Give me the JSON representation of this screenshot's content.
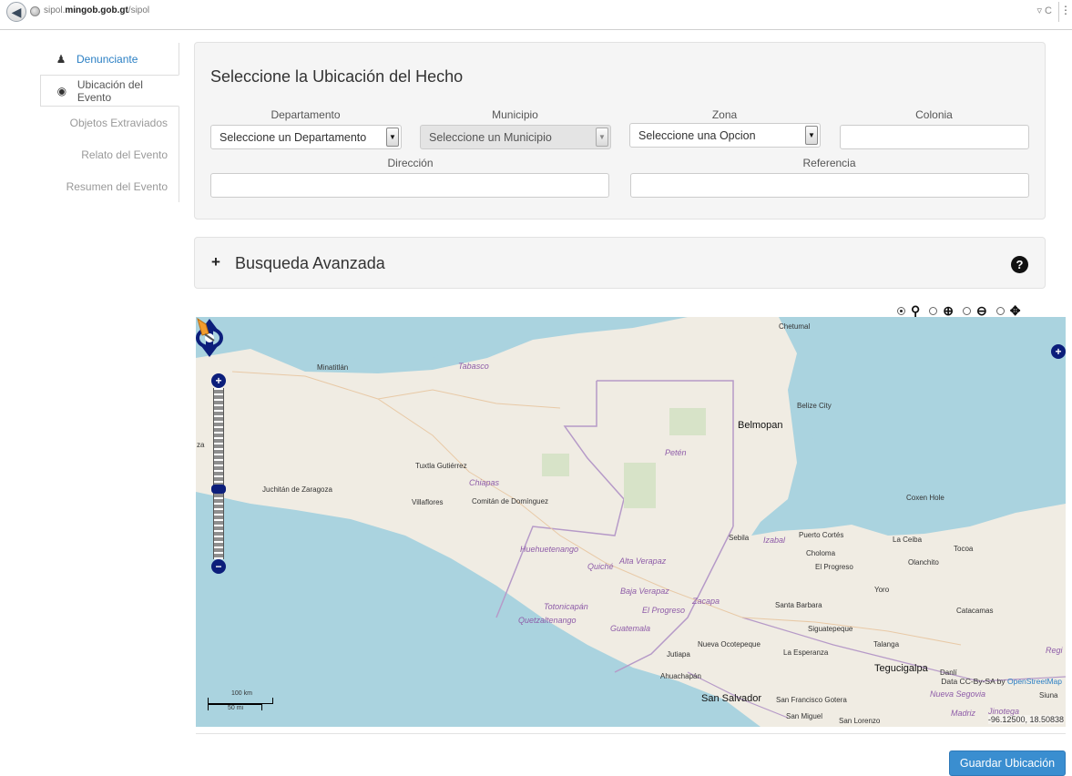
{
  "browser": {
    "url_prefix": "sipol.",
    "url_domain": "mingob.gob.gt",
    "url_path": "/sipol",
    "back_icon": "back-arrow-icon",
    "reload": "▿ C"
  },
  "nav": {
    "items": [
      {
        "label": "Denunciante",
        "icon": "user-icon",
        "state": "active"
      },
      {
        "label": "Ubicación del Evento",
        "icon": "map-marker-icon",
        "state": "current"
      },
      {
        "label": "Objetos Extraviados",
        "state": "disabled"
      },
      {
        "label": "Relato del Evento",
        "state": "disabled"
      },
      {
        "label": "Resumen del Evento",
        "state": "disabled"
      }
    ]
  },
  "location": {
    "title": "Seleccione la Ubicación del Hecho",
    "departamento_label": "Departamento",
    "departamento_value": "Seleccione un Departamento",
    "municipio_label": "Municipio",
    "municipio_value": "Seleccione un Municipio",
    "zona_label": "Zona",
    "zona_value": "Seleccione una Opcion",
    "colonia_label": "Colonia",
    "colonia_value": "",
    "direccion_label": "Dirección",
    "direccion_value": "",
    "referencia_label": "Referencia",
    "referencia_value": ""
  },
  "advanced": {
    "plus": "+",
    "title": "Busqueda Avanzada",
    "help": "?"
  },
  "map": {
    "labels": {
      "chetumal": "Chetumal",
      "minatitlan": "Minatitlán",
      "tabasco": "Tabasco",
      "belize_city": "Belize City",
      "belmopan": "Belmopan",
      "peten": "Petén",
      "tuxtla": "Tuxtla Gutiérrez",
      "chiapas": "Chiapas",
      "juchitan": "Juchitán de Zaragoza",
      "villaflores": "Villaflores",
      "comitan": "Comitán de Domínguez",
      "coxen": "Coxen Hole",
      "sebila": "Sebila",
      "izabal": "Izabal",
      "puerto_cortes": "Puerto Cortés",
      "la_ceiba": "La Ceiba",
      "tocoa": "Tocoa",
      "choloma": "Choloma",
      "el_progreso": "El Progreso",
      "olanchito": "Olanchito",
      "huehuetenango": "Huehuetenango",
      "quiche": "Quiché",
      "alta_verapaz": "Alta Verapaz",
      "baja_verapaz": "Baja Verapaz",
      "zacapa": "Zacapa",
      "yoro": "Yoro",
      "totonicapan": "Totonicapán",
      "el_progreso_gt": "El Progreso",
      "santa_barbara": "Santa Barbara",
      "catacamas": "Catacamas",
      "quetzaltenango": "Quetzaltenango",
      "guatemala": "Guatemala",
      "siguatepeque": "Siguatepeque",
      "nueva_ocotepeque": "Nueva Ocotepeque",
      "talanga": "Talanga",
      "jutiapa": "Jutiapa",
      "la_esperanza": "La Esperanza",
      "tegucigalpa": "Tegucigalpa",
      "danli": "Danlí",
      "ahuachapan": "Ahuachapán",
      "nueva_segovia": "Nueva Segovia",
      "san_salvador": "San Salvador",
      "san_francisco": "San Francisco Gotera",
      "siuna": "Siuna",
      "san_miguel": "San Miguel",
      "san_lorenzo": "San Lorenzo",
      "madriz": "Madriz",
      "jinotega": "Jinotega",
      "region_edge": "Regi",
      "edge_a": "a",
      "edge_za": "za"
    },
    "scale_top": "100 km",
    "scale_bottom": "50 mi",
    "attribution_prefix": "Data CC-By-SA by ",
    "attribution_link": "OpenStreetMap",
    "coords": "-96.12500, 18.50838",
    "zoom_in": "+",
    "zoom_out": "−",
    "layers": "+"
  },
  "tools": {
    "pin": "pin-icon",
    "zoom_in": "zoom-in-icon",
    "zoom_out": "zoom-out-icon",
    "pan": "pan-arrows-icon"
  },
  "actions": {
    "save_label": "Guardar Ubicación"
  }
}
